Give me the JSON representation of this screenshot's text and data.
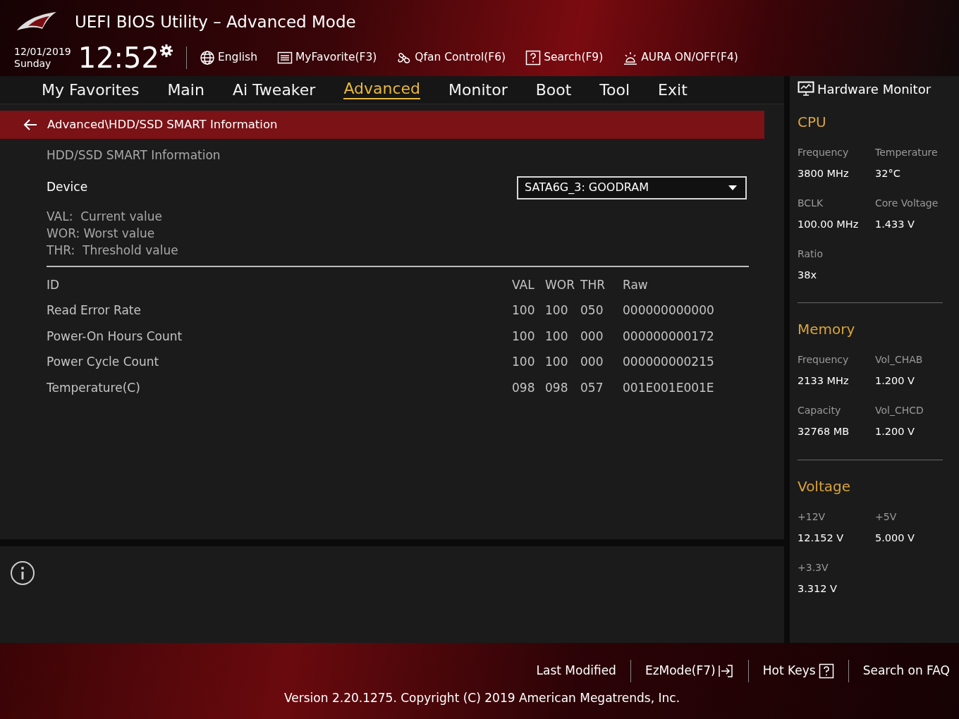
{
  "header": {
    "title": "UEFI BIOS Utility – Advanced Mode",
    "date": "12/01/2019",
    "day": "Sunday",
    "time": "12:52",
    "tools": [
      {
        "label": "English",
        "kind": "globe"
      },
      {
        "label": "MyFavorite(F3)",
        "kind": "favorite"
      },
      {
        "label": "Qfan Control(F6)",
        "kind": "fan"
      },
      {
        "label": "Search(F9)",
        "kind": "help"
      },
      {
        "label": "AURA ON/OFF(F4)",
        "kind": "aura"
      }
    ]
  },
  "menu": [
    {
      "label": "My Favorites",
      "selected": false
    },
    {
      "label": "Main",
      "selected": false
    },
    {
      "label": "Ai Tweaker",
      "selected": false
    },
    {
      "label": "Advanced",
      "selected": true
    },
    {
      "label": "Monitor",
      "selected": false
    },
    {
      "label": "Boot",
      "selected": false
    },
    {
      "label": "Tool",
      "selected": false
    },
    {
      "label": "Exit",
      "selected": false
    }
  ],
  "breadcrumb": "Advanced\\HDD/SSD SMART Information",
  "section_title": "HDD/SSD SMART Information",
  "device": {
    "label": "Device",
    "value": "SATA6G_3: GOODRAM"
  },
  "legend": [
    "VAL:  Current value",
    "WOR: Worst value",
    "THR:  Threshold value"
  ],
  "smart_table": {
    "columns": [
      "ID",
      "VAL",
      "WOR",
      "THR",
      "Raw"
    ],
    "rows": [
      [
        "Read Error Rate",
        "100",
        "100",
        "050",
        "000000000000"
      ],
      [
        "Power-On Hours Count",
        "100",
        "100",
        "000",
        "000000000172"
      ],
      [
        "Power Cycle Count",
        "100",
        "100",
        "000",
        "000000000215"
      ],
      [
        "Temperature(C)",
        "098",
        "098",
        "057",
        "001E001E001E"
      ]
    ]
  },
  "hardware_monitor": {
    "title": "Hardware Monitor",
    "groups": [
      {
        "name": "CPU",
        "items": [
          {
            "label": "Frequency",
            "value": "3800 MHz"
          },
          {
            "label": "Temperature",
            "value": "32°C"
          },
          {
            "label": "BCLK",
            "value": "100.00 MHz"
          },
          {
            "label": "Core Voltage",
            "value": "1.433 V"
          },
          {
            "label": "Ratio",
            "value": "38x"
          }
        ]
      },
      {
        "name": "Memory",
        "items": [
          {
            "label": "Frequency",
            "value": "2133 MHz"
          },
          {
            "label": "Vol_CHAB",
            "value": "1.200 V"
          },
          {
            "label": "Capacity",
            "value": "32768 MB"
          },
          {
            "label": "Vol_CHCD",
            "value": "1.200 V"
          }
        ]
      },
      {
        "name": "Voltage",
        "items": [
          {
            "label": "+12V",
            "value": "12.152 V"
          },
          {
            "label": "+5V",
            "value": "5.000 V"
          },
          {
            "label": "+3.3V",
            "value": "3.312 V"
          }
        ]
      }
    ]
  },
  "footer": {
    "links": [
      {
        "label": "Last Modified",
        "kind": "text"
      },
      {
        "label": "EzMode(F7)",
        "kind": "exit"
      },
      {
        "label": "Hot Keys",
        "kind": "help"
      },
      {
        "label": "Search on FAQ",
        "kind": "text"
      }
    ],
    "version": "Version 2.20.1275. Copyright (C) 2019 American Megatrends, Inc."
  }
}
